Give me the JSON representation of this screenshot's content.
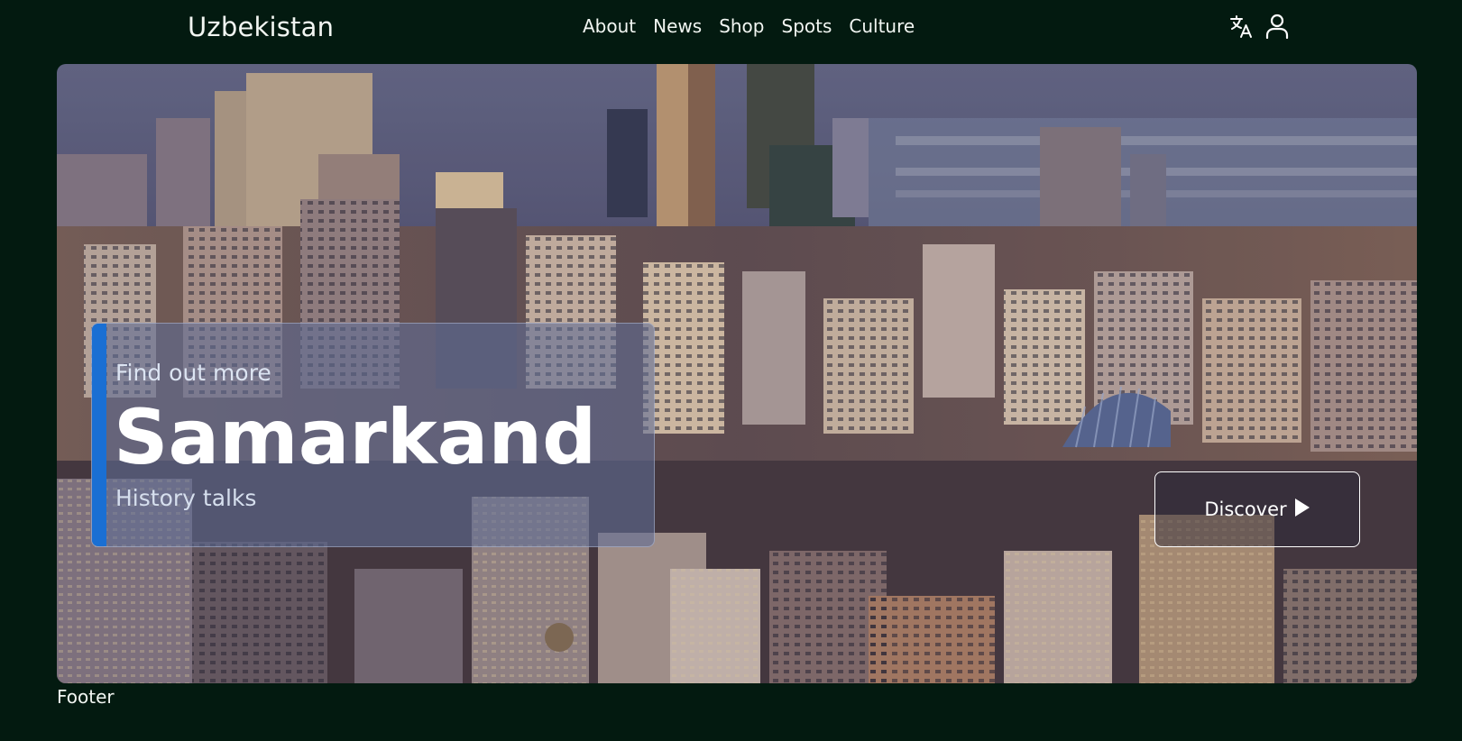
{
  "header": {
    "brand": "Uzbekistan",
    "nav": [
      {
        "label": "About"
      },
      {
        "label": "News"
      },
      {
        "label": "Shop"
      },
      {
        "label": "Spots"
      },
      {
        "label": "Culture"
      }
    ],
    "icons": [
      "translate-icon",
      "user-icon"
    ]
  },
  "hero": {
    "eyebrow": "Find out more",
    "title": "Samarkand",
    "subtitle": "History talks",
    "cta_label": "Discover",
    "cta_icon": "play-triangle-icon",
    "background": "city-skyline-photo",
    "accent_color": "#1a6fd3"
  },
  "footer": {
    "label": "Footer"
  },
  "colors": {
    "page_background": "#031a10",
    "text": "#f2f6f2"
  }
}
